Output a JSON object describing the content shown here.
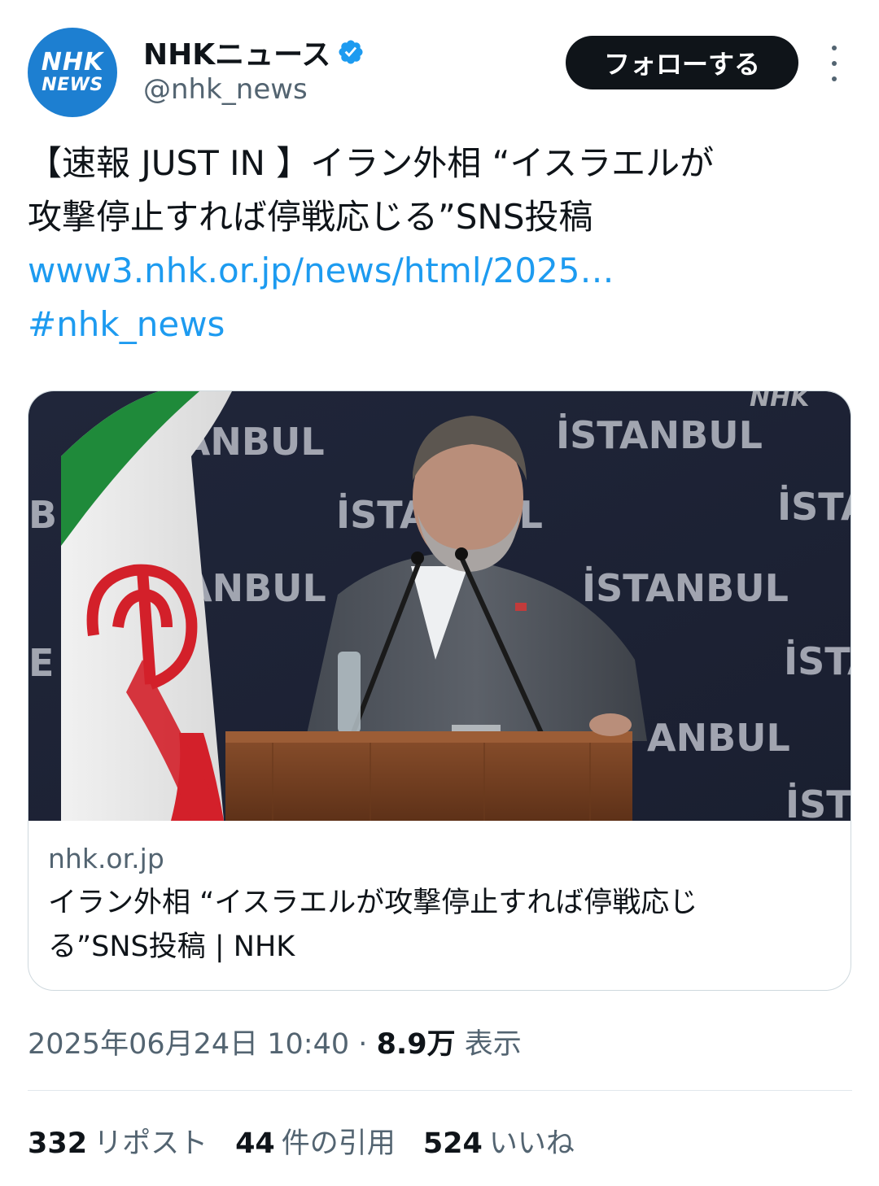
{
  "header": {
    "avatar_line1": "NHK",
    "avatar_line2": "NEWS",
    "display_name": "NHKニュース",
    "handle": "@nhk_news",
    "follow_label": "フォローする",
    "verified_color": "#1d9bf0",
    "avatar_color": "#1d7fd1"
  },
  "tweet": {
    "line1": "【速報 JUST IN 】イラン外相 “イスラエルが",
    "line2": "攻撃停止すれば停戦応じる”SNS投稿",
    "link": "www3.nhk.or.jp/news/html/2025…",
    "hashtag": "#nhk_news"
  },
  "card": {
    "image": {
      "logo": "NHK",
      "backdrop_word": "İSTANBUL"
    },
    "domain": "nhk.or.jp",
    "title_line1": "イラン外相 “イスラエルが攻撃停止すれば停戦応じ",
    "title_line2": "る”SNS投稿 | NHK"
  },
  "meta": {
    "date": "2025年06月24日 10:40",
    "separator": "·",
    "views_count": "8.9万",
    "views_label": "表示"
  },
  "stats": {
    "reposts_count": "332",
    "reposts_label": "リポスト",
    "quotes_count": "44",
    "quotes_label": "件の引用",
    "likes_count": "524",
    "likes_label": "いいね"
  }
}
